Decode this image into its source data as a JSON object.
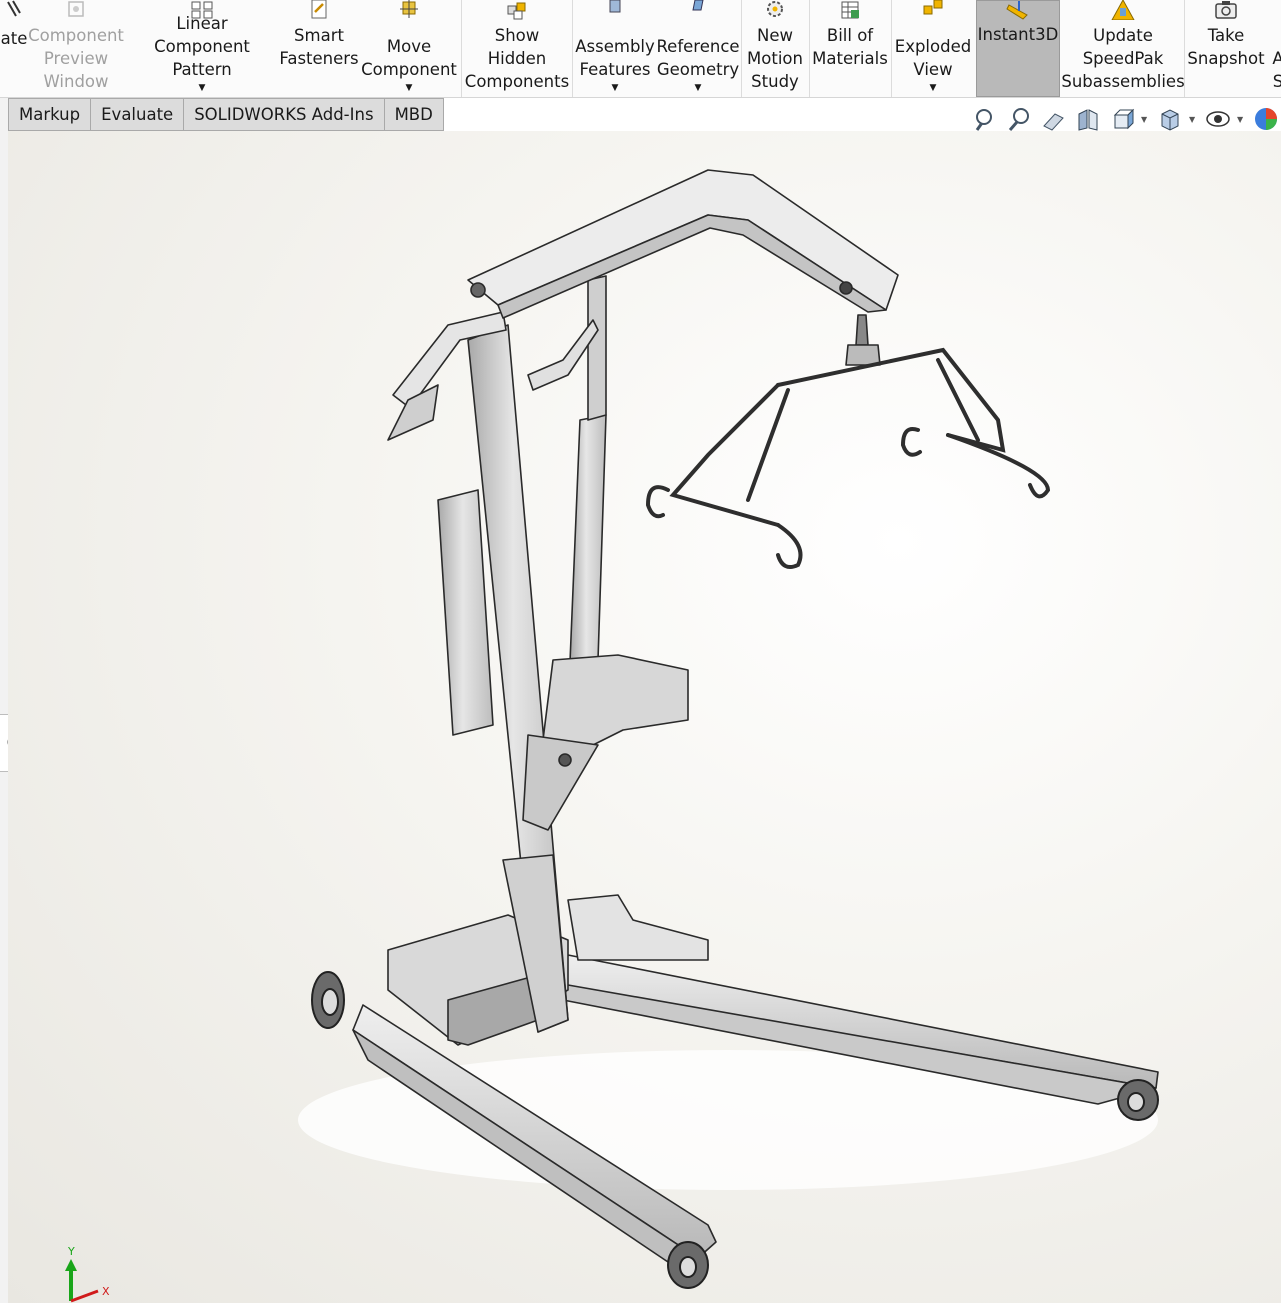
{
  "ribbon": {
    "buttons": [
      {
        "id": "update",
        "label": "ate",
        "icon": "paperclip-icon",
        "disabled": false,
        "dropdown": false
      },
      {
        "id": "component-preview",
        "label": "Component\nPreview\nWindow",
        "icon": "component-preview-icon",
        "disabled": true,
        "dropdown": false
      },
      {
        "id": "linear-pattern",
        "label": "Linear Component\nPattern",
        "icon": "linear-pattern-icon",
        "disabled": false,
        "dropdown": true
      },
      {
        "id": "smart-fasteners",
        "label": "Smart\nFasteners",
        "icon": "smart-fastener-icon",
        "disabled": false,
        "dropdown": false
      },
      {
        "id": "move-component",
        "label": "Move\nComponent",
        "icon": "move-component-icon",
        "disabled": false,
        "dropdown": true
      },
      {
        "id": "show-hidden",
        "label": "Show\nHidden\nComponents",
        "icon": "show-hidden-icon",
        "disabled": false,
        "dropdown": false
      },
      {
        "id": "assembly-features",
        "label": "Assembly\nFeatures",
        "icon": "assembly-features-icon",
        "disabled": false,
        "dropdown": true
      },
      {
        "id": "reference-geometry",
        "label": "Reference\nGeometry",
        "icon": "reference-geometry-icon",
        "disabled": false,
        "dropdown": true
      },
      {
        "id": "motion-study",
        "label": "New\nMotion\nStudy",
        "icon": "motion-study-icon",
        "disabled": false,
        "dropdown": false
      },
      {
        "id": "bom",
        "label": "Bill of\nMaterials",
        "icon": "bill-of-materials-icon",
        "disabled": false,
        "dropdown": false
      },
      {
        "id": "exploded-view",
        "label": "Exploded\nView",
        "icon": "exploded-view-icon",
        "disabled": false,
        "dropdown": true
      },
      {
        "id": "instant3d",
        "label": "Instant3D",
        "icon": "instant3d-icon",
        "disabled": false,
        "dropdown": false,
        "active": true
      },
      {
        "id": "speedpak",
        "label": "Update\nSpeedPak\nSubassemblies",
        "icon": "speedpak-icon",
        "disabled": false,
        "dropdown": false
      },
      {
        "id": "snapshot",
        "label": "Take\nSnapshot",
        "icon": "camera-icon",
        "disabled": false,
        "dropdown": false
      },
      {
        "id": "more",
        "label": "A\nS",
        "icon": "more-icon",
        "disabled": false,
        "dropdown": false
      }
    ]
  },
  "tabs": [
    "Markup",
    "Evaluate",
    "SOLIDWORKS Add-Ins",
    "MBD"
  ],
  "hud": {
    "icons": [
      "zoom-to-fit-icon",
      "zoom-to-area-icon",
      "previous-view-icon",
      "section-view-icon",
      "view-orientation-icon",
      "display-style-icon",
      "hide-show-items-icon",
      "edit-appearance-icon"
    ]
  },
  "triad": {
    "y_label": "Y",
    "x_label": "X"
  },
  "colors": {
    "accent": "#f0b400",
    "viewport_bg": "#eeece6",
    "active_button": "#b9b9b9",
    "triad_y": "#19a519",
    "triad_x": "#d01a1a"
  }
}
